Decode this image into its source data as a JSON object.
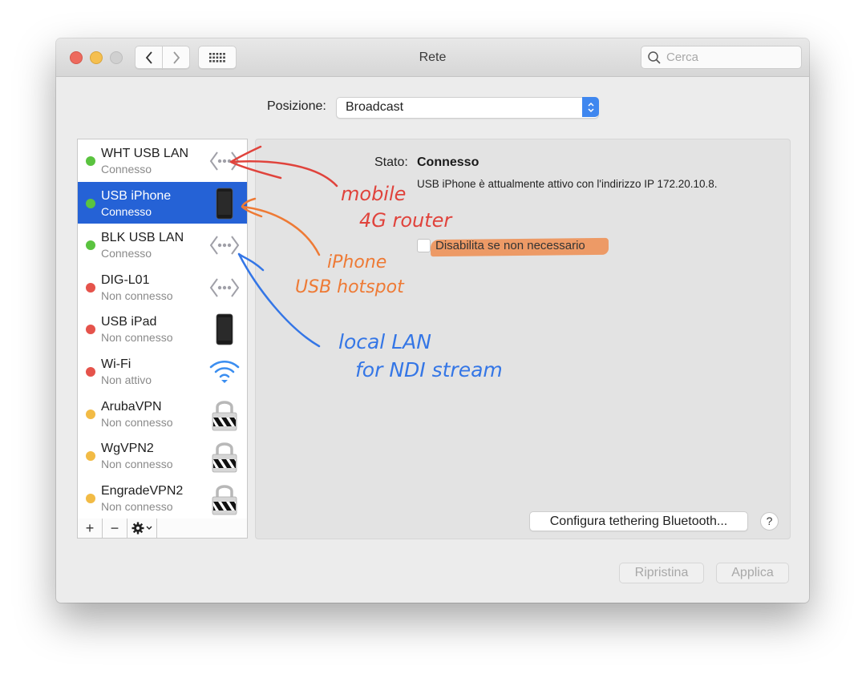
{
  "window": {
    "title": "Rete",
    "search_placeholder": "Cerca"
  },
  "location": {
    "label": "Posizione:",
    "selected": "Broadcast"
  },
  "services": [
    {
      "name": "WHT USB LAN",
      "status": "Connesso",
      "status_color": "#5ac33f",
      "icon": "ethernet-icon",
      "selected": false
    },
    {
      "name": "USB iPhone",
      "status": "Connesso",
      "status_color": "#5ac33f",
      "icon": "iphone-icon",
      "selected": true
    },
    {
      "name": "BLK USB LAN",
      "status": "Connesso",
      "status_color": "#5ac33f",
      "icon": "ethernet-icon",
      "selected": false
    },
    {
      "name": "DIG-L01",
      "status": "Non connesso",
      "status_color": "#e5534b",
      "icon": "ethernet-icon",
      "selected": false
    },
    {
      "name": "USB iPad",
      "status": "Non connesso",
      "status_color": "#e5534b",
      "icon": "iphone-icon",
      "selected": false
    },
    {
      "name": "Wi-Fi",
      "status": "Non attivo",
      "status_color": "#e5534b",
      "icon": "wifi-icon",
      "selected": false
    },
    {
      "name": "ArubaVPN",
      "status": "Non connesso",
      "status_color": "#f2bb45",
      "icon": "vpn-lock-icon",
      "selected": false
    },
    {
      "name": "WgVPN2",
      "status": "Non connesso",
      "status_color": "#f2bb45",
      "icon": "vpn-lock-icon",
      "selected": false
    },
    {
      "name": "EngradeVPN2",
      "status": "Non connesso",
      "status_color": "#f2bb45",
      "icon": "vpn-lock-icon",
      "selected": false
    }
  ],
  "list_toolbar": {
    "add": "+",
    "remove": "−"
  },
  "detail": {
    "status_label": "Stato:",
    "status_value": "Connesso",
    "description": "USB iPhone è attualmente attivo con l'indirizzo IP 172.20.10.8.",
    "checkbox_label": "Disabilita se non necessario",
    "checkbox_checked": false,
    "bluetooth_button": "Configura tethering Bluetooth...",
    "help": "?"
  },
  "footer": {
    "revert": "Ripristina",
    "apply": "Applica"
  },
  "annotations": {
    "red_line1": "mobile",
    "red_line2": "4G router",
    "orange_line1": "iPhone",
    "orange_line2": "USB hotspot",
    "blue_line1": "local LAN",
    "blue_line2": "for NDI stream",
    "colors": {
      "red": "#e0433c",
      "orange": "#ee7a35",
      "blue": "#3476e6"
    }
  }
}
